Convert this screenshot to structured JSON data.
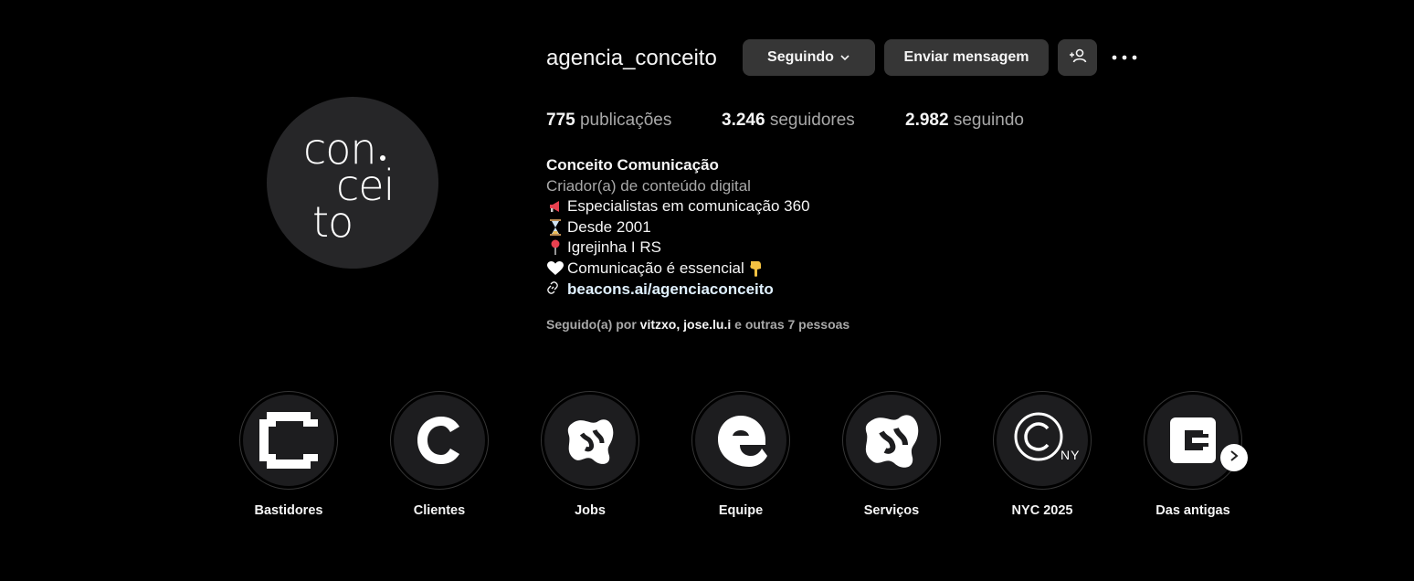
{
  "avatar": {
    "logo_line1": "con",
    "logo_line2": "cei",
    "logo_line3": "to"
  },
  "header": {
    "username": "agencia_conceito",
    "following_label": "Seguindo",
    "message_label": "Enviar mensagem",
    "suggest_icon": "person-plus-icon",
    "more_icon": "more-options-icon"
  },
  "stats": {
    "posts_count": "775",
    "posts_label": "publicações",
    "followers_count": "3.246",
    "followers_label": "seguidores",
    "following_count": "2.982",
    "following_label": "seguindo"
  },
  "bio": {
    "name": "Conceito Comunicação",
    "category": "Criador(a) de conteúdo digital",
    "lines": [
      {
        "icon": "megaphone-icon",
        "text": "Especialistas em comunicação 360"
      },
      {
        "icon": "hourglass-icon",
        "text": "Desde 2001"
      },
      {
        "icon": "pin-icon",
        "text": "Igrejinha I RS"
      },
      {
        "icon": "white-heart-icon",
        "text": "Comunicação é essencial",
        "trail_icon": "pointing-down-icon"
      }
    ],
    "link": "beacons.ai/agenciaconceito"
  },
  "followed_by": {
    "prefix": "Seguido(a) por",
    "user1": "vitzxo",
    "sep": ",",
    "user2": "jose.lu.i",
    "suffix": "e outras 7 pessoas"
  },
  "highlights": [
    {
      "label": "Bastidores"
    },
    {
      "label": "Clientes"
    },
    {
      "label": "Jobs"
    },
    {
      "label": "Equipe"
    },
    {
      "label": "Serviços"
    },
    {
      "label": "NYC 2025",
      "badge": "NY"
    },
    {
      "label": "Das antigas"
    }
  ],
  "colors": {
    "background": "#000000",
    "button": "#363636",
    "link": "#e0f1ff",
    "muted": "#a8a8a8"
  }
}
